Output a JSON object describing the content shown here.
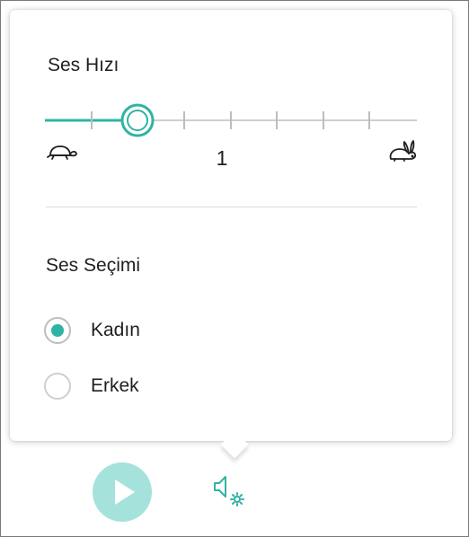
{
  "speed_section": {
    "title": "Ses Hızı",
    "slider": {
      "value_label": "1",
      "min_icon": "turtle-icon",
      "max_icon": "rabbit-icon",
      "level_fraction": 0.25,
      "tick_count": 7
    }
  },
  "voice_section": {
    "title": "Ses Seçimi",
    "options": [
      {
        "label": "Kadın",
        "selected": true
      },
      {
        "label": "Erkek",
        "selected": false
      }
    ]
  },
  "controls": {
    "play_icon": "play-icon",
    "voice_settings_icon": "speaker-gear-icon"
  },
  "colors": {
    "accent": "#2fb3a3",
    "play_button_bg": "#a6e2dc",
    "track_inactive": "#cfcfcf"
  }
}
